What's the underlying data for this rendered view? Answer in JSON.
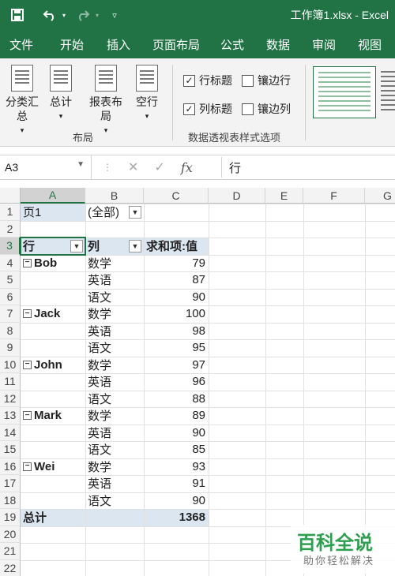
{
  "titlebar": {
    "title": "工作簿1.xlsx  -  Excel",
    "save_icon": "save-icon",
    "undo_icon": "undo-icon",
    "redo_icon": "redo-icon"
  },
  "tabs": [
    "文件",
    "开始",
    "插入",
    "页面布局",
    "公式",
    "数据",
    "审阅",
    "视图"
  ],
  "ribbon": {
    "subtotal": "分类汇总",
    "grandtotal": "总计",
    "report_layout": "报表布局",
    "blank_rows": "空行",
    "layout_group": "布局",
    "row_headers": "行标题",
    "col_headers": "列标题",
    "banded_rows": "镶边行",
    "banded_cols": "镶边列",
    "style_options_group": "数据透视表样式选项"
  },
  "formula_bar": {
    "name_box": "A3",
    "cancel": "✕",
    "enter": "✓",
    "fx": "fx",
    "value": "行"
  },
  "columns": [
    "A",
    "B",
    "C",
    "D",
    "E",
    "F",
    "G"
  ],
  "rows": [
    "1",
    "2",
    "3",
    "4",
    "5",
    "6",
    "7",
    "8",
    "9",
    "10",
    "11",
    "12",
    "13",
    "14",
    "15",
    "16",
    "17",
    "18",
    "19",
    "20",
    "21",
    "22"
  ],
  "pivot": {
    "page_label": "页1",
    "page_value": "(全部)",
    "row_header": "行",
    "col_header": "列",
    "value_header": "求和项:值",
    "groups": [
      {
        "name": "Bob",
        "items": [
          {
            "subject": "数学",
            "value": "79"
          },
          {
            "subject": "英语",
            "value": "87"
          },
          {
            "subject": "语文",
            "value": "90"
          }
        ]
      },
      {
        "name": "Jack",
        "items": [
          {
            "subject": "数学",
            "value": "100"
          },
          {
            "subject": "英语",
            "value": "98"
          },
          {
            "subject": "语文",
            "value": "95"
          }
        ]
      },
      {
        "name": "John",
        "items": [
          {
            "subject": "数学",
            "value": "97"
          },
          {
            "subject": "英语",
            "value": "96"
          },
          {
            "subject": "语文",
            "value": "88"
          }
        ]
      },
      {
        "name": "Mark",
        "items": [
          {
            "subject": "数学",
            "value": "89"
          },
          {
            "subject": "英语",
            "value": "90"
          },
          {
            "subject": "语文",
            "value": "85"
          }
        ]
      },
      {
        "name": "Wei",
        "items": [
          {
            "subject": "数学",
            "value": "93"
          },
          {
            "subject": "英语",
            "value": "91"
          },
          {
            "subject": "语文",
            "value": "90"
          }
        ]
      }
    ],
    "total_label": "总计",
    "total_value": "1368"
  },
  "watermark": {
    "title": "百科全说",
    "subtitle": "助你轻松解决"
  },
  "colors": {
    "accent": "#217346",
    "pivot_fill": "#dce6f1"
  }
}
